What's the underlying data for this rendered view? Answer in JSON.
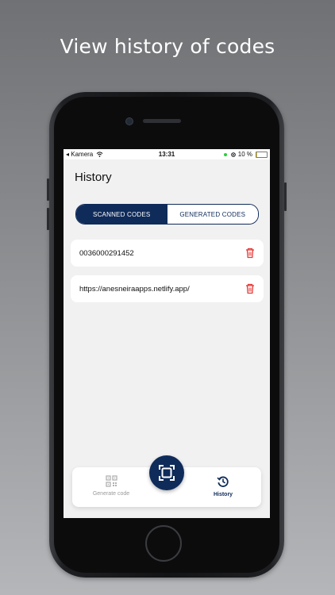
{
  "headline": "View history of codes",
  "status_bar": {
    "carrier": "◂ Kamera",
    "time": "13:31",
    "battery_text": "10 %",
    "battery_level": 0.1
  },
  "page": {
    "title": "History"
  },
  "tabs": [
    {
      "label": "SCANNED CODES",
      "active": true
    },
    {
      "label": "GENERATED CODES",
      "active": false
    }
  ],
  "history_items": [
    {
      "value": "0036000291452"
    },
    {
      "value": "https://anesneiraapps.netlify.app/"
    }
  ],
  "bottom_nav": {
    "generate_label": "Generate code",
    "history_label": "History"
  },
  "colors": {
    "primary": "#0f2b5a",
    "delete": "#e53935",
    "inactive": "#9a9a9a"
  },
  "icons": {
    "scan": "scan-frame-icon",
    "delete": "trash-icon",
    "generate": "qr-code-icon",
    "history": "history-icon"
  }
}
